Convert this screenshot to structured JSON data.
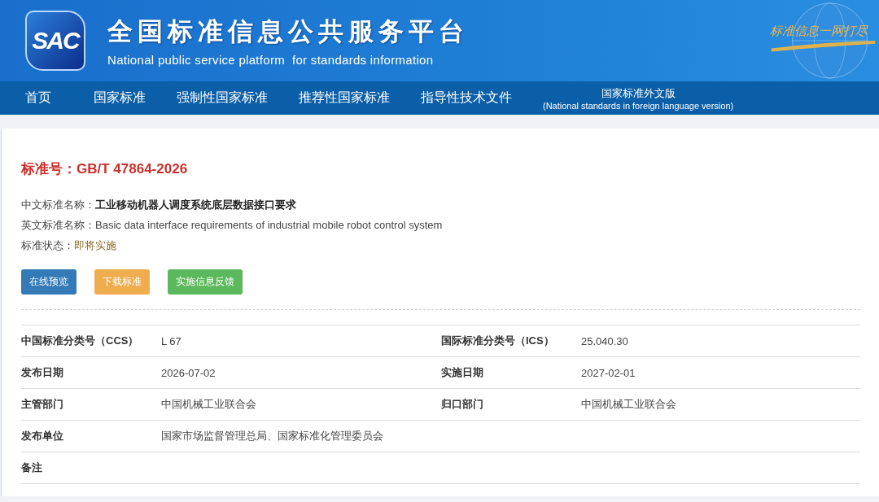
{
  "header": {
    "logo_text": "SAC",
    "title": "全国标准信息公共服务平台",
    "subtitle": "National public service platform  for standards information",
    "slogan": "标准信息一网打尽"
  },
  "nav": [
    {
      "label": "首页"
    },
    {
      "label": "国家标准"
    },
    {
      "label": "强制性国家标准"
    },
    {
      "label": "推荐性国家标准"
    },
    {
      "label": "指导性技术文件"
    },
    {
      "label": "国家标准外文版",
      "sublabel": "(National standards in foreign language version)"
    }
  ],
  "standard": {
    "number_label": "标准号：",
    "number": "GB/T 47864-2026",
    "fields": [
      {
        "label": "中文标准名称：",
        "value": "工业移动机器人调度系统底层数据接口要求",
        "kind": "bold"
      },
      {
        "label": "英文标准名称：",
        "value": "Basic data interface requirements of industrial mobile robot control system",
        "kind": "plain"
      },
      {
        "label": "标准状态：",
        "value": "即将实施",
        "kind": "status"
      }
    ],
    "buttons": [
      {
        "label": "在线预览",
        "color": "#337ab7"
      },
      {
        "label": "下载标准",
        "color": "#f0ad4e"
      },
      {
        "label": "实施信息反馈",
        "color": "#5cb85c"
      }
    ]
  },
  "table": {
    "rows": [
      [
        {
          "label": "中国标准分类号（CCS）",
          "value": "L 67"
        },
        {
          "label": "国际标准分类号（ICS）",
          "value": "25.040.30"
        }
      ],
      [
        {
          "label": "发布日期",
          "value": "2026-07-02"
        },
        {
          "label": "实施日期",
          "value": "2027-02-01"
        }
      ],
      [
        {
          "label": "主管部门",
          "value": "中国机械工业联合会"
        },
        {
          "label": "归口部门",
          "value": "中国机械工业联合会"
        }
      ],
      [
        {
          "label": "发布单位",
          "value": "国家市场监督管理总局、国家标准化管理委员会"
        }
      ],
      [
        {
          "label": "备注"
        }
      ]
    ]
  }
}
